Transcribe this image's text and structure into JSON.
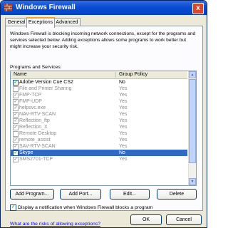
{
  "window": {
    "title": "Windows Firewall",
    "close_glyph": "x"
  },
  "tabs": [
    {
      "label": "General",
      "active": false
    },
    {
      "label": "Exceptions",
      "active": true
    },
    {
      "label": "Advanced",
      "active": false
    }
  ],
  "description": "Windows Firewall is blocking incoming network connections, except for the programs and services selected below. Adding exceptions allows some programs to work better but might increase your security risk.",
  "list": {
    "label": "Programs and Services:",
    "columns": {
      "name": "Name",
      "group_policy": "Group Policy"
    },
    "rows": [
      {
        "name": "Adobe Version Cue CS2",
        "gp": "No",
        "checked": true,
        "disabled": false,
        "selected": false
      },
      {
        "name": "File and Printer Sharing",
        "gp": "Yes",
        "checked": false,
        "disabled": true,
        "selected": false
      },
      {
        "name": "FMP-TCP",
        "gp": "Yes",
        "checked": true,
        "disabled": true,
        "selected": false
      },
      {
        "name": "FMP-UDP",
        "gp": "Yes",
        "checked": true,
        "disabled": true,
        "selected": false
      },
      {
        "name": "helpsvc.exe",
        "gp": "Yes",
        "checked": true,
        "disabled": true,
        "selected": false
      },
      {
        "name": "NAV-RTV-SCAN",
        "gp": "Yes",
        "checked": true,
        "disabled": true,
        "selected": false
      },
      {
        "name": "Reflection_ftp",
        "gp": "Yes",
        "checked": true,
        "disabled": true,
        "selected": false
      },
      {
        "name": "Reflection_X",
        "gp": "Yes",
        "checked": true,
        "disabled": true,
        "selected": false
      },
      {
        "name": "Remote Desktop",
        "gp": "Yes",
        "checked": false,
        "disabled": true,
        "selected": false
      },
      {
        "name": "remote_assist",
        "gp": "Yes",
        "checked": true,
        "disabled": true,
        "selected": false
      },
      {
        "name": "SAV-RTV-SCAN",
        "gp": "Yes",
        "checked": true,
        "disabled": true,
        "selected": false
      },
      {
        "name": "Skype",
        "gp": "No",
        "checked": true,
        "disabled": false,
        "selected": true
      },
      {
        "name": "SMS2701-TCP",
        "gp": "Yes",
        "checked": true,
        "disabled": true,
        "selected": false
      }
    ]
  },
  "buttons": {
    "add_program": "Add Program...",
    "add_port": "Add Port...",
    "edit": "Edit...",
    "delete": "Delete"
  },
  "notify": {
    "label": "Display a notification when Windows Firewall blocks a program",
    "checked": true
  },
  "risk_link": "What are the risks of allowing exceptions?",
  "footer": {
    "ok": "OK",
    "cancel": "Cancel"
  },
  "check_glyph": "✓",
  "colors": {
    "titlebar": "#0a4bd1",
    "selected_row": "#316ac5",
    "link": "#0000ff",
    "active_tab_accent": "#f7a329"
  }
}
